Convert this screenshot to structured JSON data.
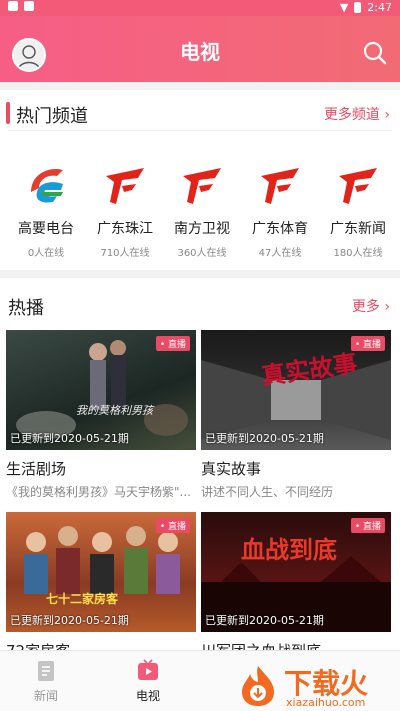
{
  "status": {
    "time": "2:47"
  },
  "header": {
    "title": "电视"
  },
  "hot_channels": {
    "title": "热门频道",
    "more": "更多频道 ›",
    "items": [
      {
        "name": "高要电台",
        "online": "0人在线",
        "icon": "gaoyao-logo",
        "color": "#e63c2e"
      },
      {
        "name": "广东珠江",
        "online": "710人在线",
        "icon": "gd-logo",
        "color": "#e2231a"
      },
      {
        "name": "南方卫视",
        "online": "360人在线",
        "icon": "gd-logo",
        "color": "#e2231a"
      },
      {
        "name": "广东体育",
        "online": "47人在线",
        "icon": "gd-logo",
        "color": "#e2231a"
      },
      {
        "name": "广东新闻",
        "online": "180人在线",
        "icon": "gd-logo",
        "color": "#e2231a"
      }
    ]
  },
  "hot_play": {
    "title": "热播",
    "more": "更多 ›",
    "items": [
      {
        "badge": "• 直播",
        "update": "已更新到2020-05-21期",
        "title": "生活剧场",
        "subtitle": "《我的莫格利男孩》马天宇杨紫\"...",
        "thumb_text": "我的莫格利男孩"
      },
      {
        "badge": "• 直播",
        "update": "已更新到2020-05-21期",
        "title": "真实故事",
        "subtitle": "讲述不同人生、不同经历",
        "thumb_text": "真实故事"
      },
      {
        "badge": "• 直播",
        "update": "已更新到2020-05-21期",
        "title": "72家房客",
        "subtitle": "",
        "thumb_text": "七十二家房客"
      },
      {
        "badge": "• 直播",
        "update": "已更新到2020-05-21期",
        "title": "川军团之血战到底",
        "subtitle": "",
        "thumb_text": "血战到底"
      }
    ]
  },
  "bottom_nav": {
    "items": [
      {
        "label": "新闻",
        "active": false
      },
      {
        "label": "电视",
        "active": true
      }
    ]
  },
  "watermark": {
    "brand": "下载火",
    "domain": "xiazaihuo.com"
  }
}
